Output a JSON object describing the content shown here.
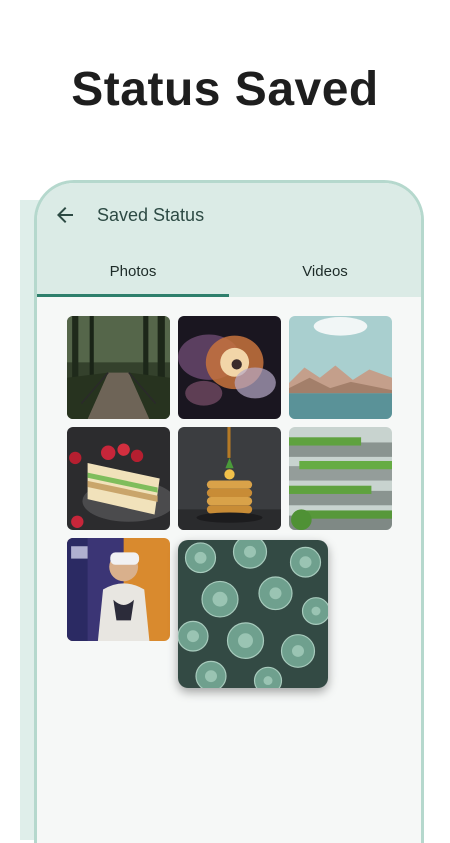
{
  "headline": "Status Saved",
  "app": {
    "title": "Saved Status",
    "tabs": [
      {
        "label": "Photos",
        "selected": true
      },
      {
        "label": "Videos",
        "selected": false
      }
    ]
  },
  "icons": {
    "back": "back-arrow-icon"
  },
  "colors": {
    "accent": "#2e7f6c",
    "appbar": "#dbebe6",
    "frame_border": "#b5d8cd"
  },
  "gallery": [
    {
      "name": "forest-bridge-photo"
    },
    {
      "name": "colorful-smoke-photo"
    },
    {
      "name": "mountain-sea-photo"
    },
    {
      "name": "strawberry-cake-photo"
    },
    {
      "name": "pancake-stack-photo"
    },
    {
      "name": "green-terrace-building-photo"
    },
    {
      "name": "vr-headset-person-photo"
    },
    {
      "name": "succulent-plants-photo"
    }
  ]
}
